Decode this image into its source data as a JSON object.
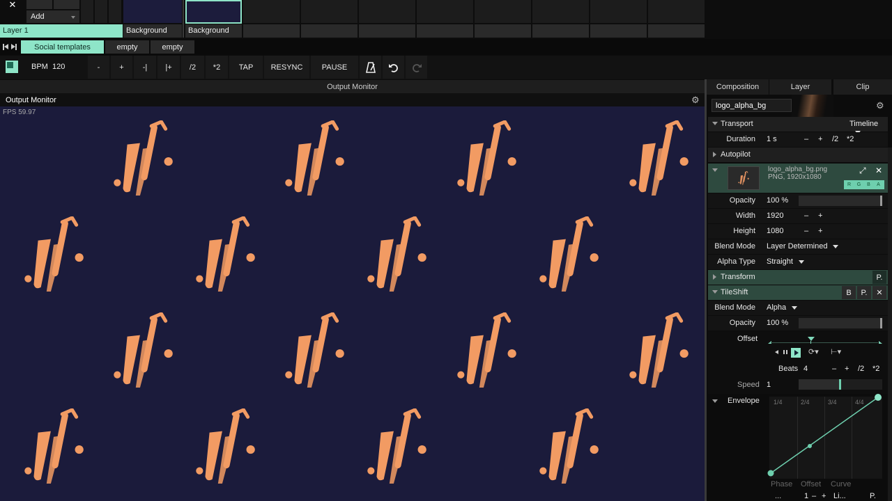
{
  "top_bar": {
    "close_glyph": "✕",
    "add_label": "Add",
    "layer_label": "Layer 1",
    "clips": [
      {
        "label": "Background"
      },
      {
        "label": "Background"
      }
    ]
  },
  "deck": {
    "tabs": [
      {
        "label": "Social templates"
      },
      {
        "label": "empty"
      },
      {
        "label": "empty"
      }
    ]
  },
  "transport_bar": {
    "bpm_label": "BPM",
    "bpm_value": "120",
    "buttons": {
      "minus": "-",
      "plus": "+",
      "nudge_back": "-|",
      "nudge_forward": "|+",
      "half": "/2",
      "double": "*2",
      "tap": "TAP",
      "resync": "RESYNC",
      "pause": "PAUSE"
    }
  },
  "output_monitor": {
    "header": "Output Monitor",
    "title": "Output Monitor",
    "fps": "FPS 59.97",
    "bg_color": "#1b1b3b",
    "logo_color": "#f29b63"
  },
  "panel": {
    "tabs": [
      {
        "label": "Composition"
      },
      {
        "label": "Layer"
      },
      {
        "label": "Clip"
      }
    ],
    "name_field": "logo_alpha_bg",
    "transport": {
      "title": "Transport",
      "mode": "Timeline",
      "duration_label": "Duration",
      "duration_value": "1 s",
      "ops": {
        "minus": "–",
        "plus": "+",
        "half": "/2",
        "double": "*2"
      }
    },
    "autopilot": "Autopilot",
    "source": {
      "filename": "logo_alpha_bg.png",
      "meta": "PNG, 1920x1080",
      "channels": [
        "R",
        "G",
        "B",
        "A"
      ]
    },
    "opacity": {
      "label": "Opacity",
      "value": "100 %",
      "level": 1.0
    },
    "width": {
      "label": "Width",
      "value": "1920",
      "minus": "–",
      "plus": "+"
    },
    "height": {
      "label": "Height",
      "value": "1080",
      "minus": "–",
      "plus": "+"
    },
    "blend_mode": {
      "label": "Blend Mode",
      "value": "Layer Determined"
    },
    "alpha_type": {
      "label": "Alpha Type",
      "value": "Straight"
    },
    "transform": {
      "title": "Transform",
      "p": "P."
    },
    "tileshift": {
      "title": "TileShift",
      "b": "B",
      "p": "P.",
      "blend_label": "Blend Mode",
      "blend_value": "Alpha",
      "opacity_label": "Opacity",
      "opacity_value": "100 %",
      "offset_label": "Offset",
      "beats_label": "Beats",
      "beats_value": "4",
      "speed_label": "Speed",
      "speed_value": "1",
      "envelope_label": "Envelope",
      "envelope_ticks": [
        "1/4",
        "2/4",
        "3/4",
        "4/4"
      ],
      "envelope_footer": [
        "Phase",
        "Offset",
        "Curve"
      ],
      "bottom": {
        "dots": "...",
        "one": "1",
        "plus": "+",
        "li": "Li...",
        "p": "P."
      }
    }
  }
}
